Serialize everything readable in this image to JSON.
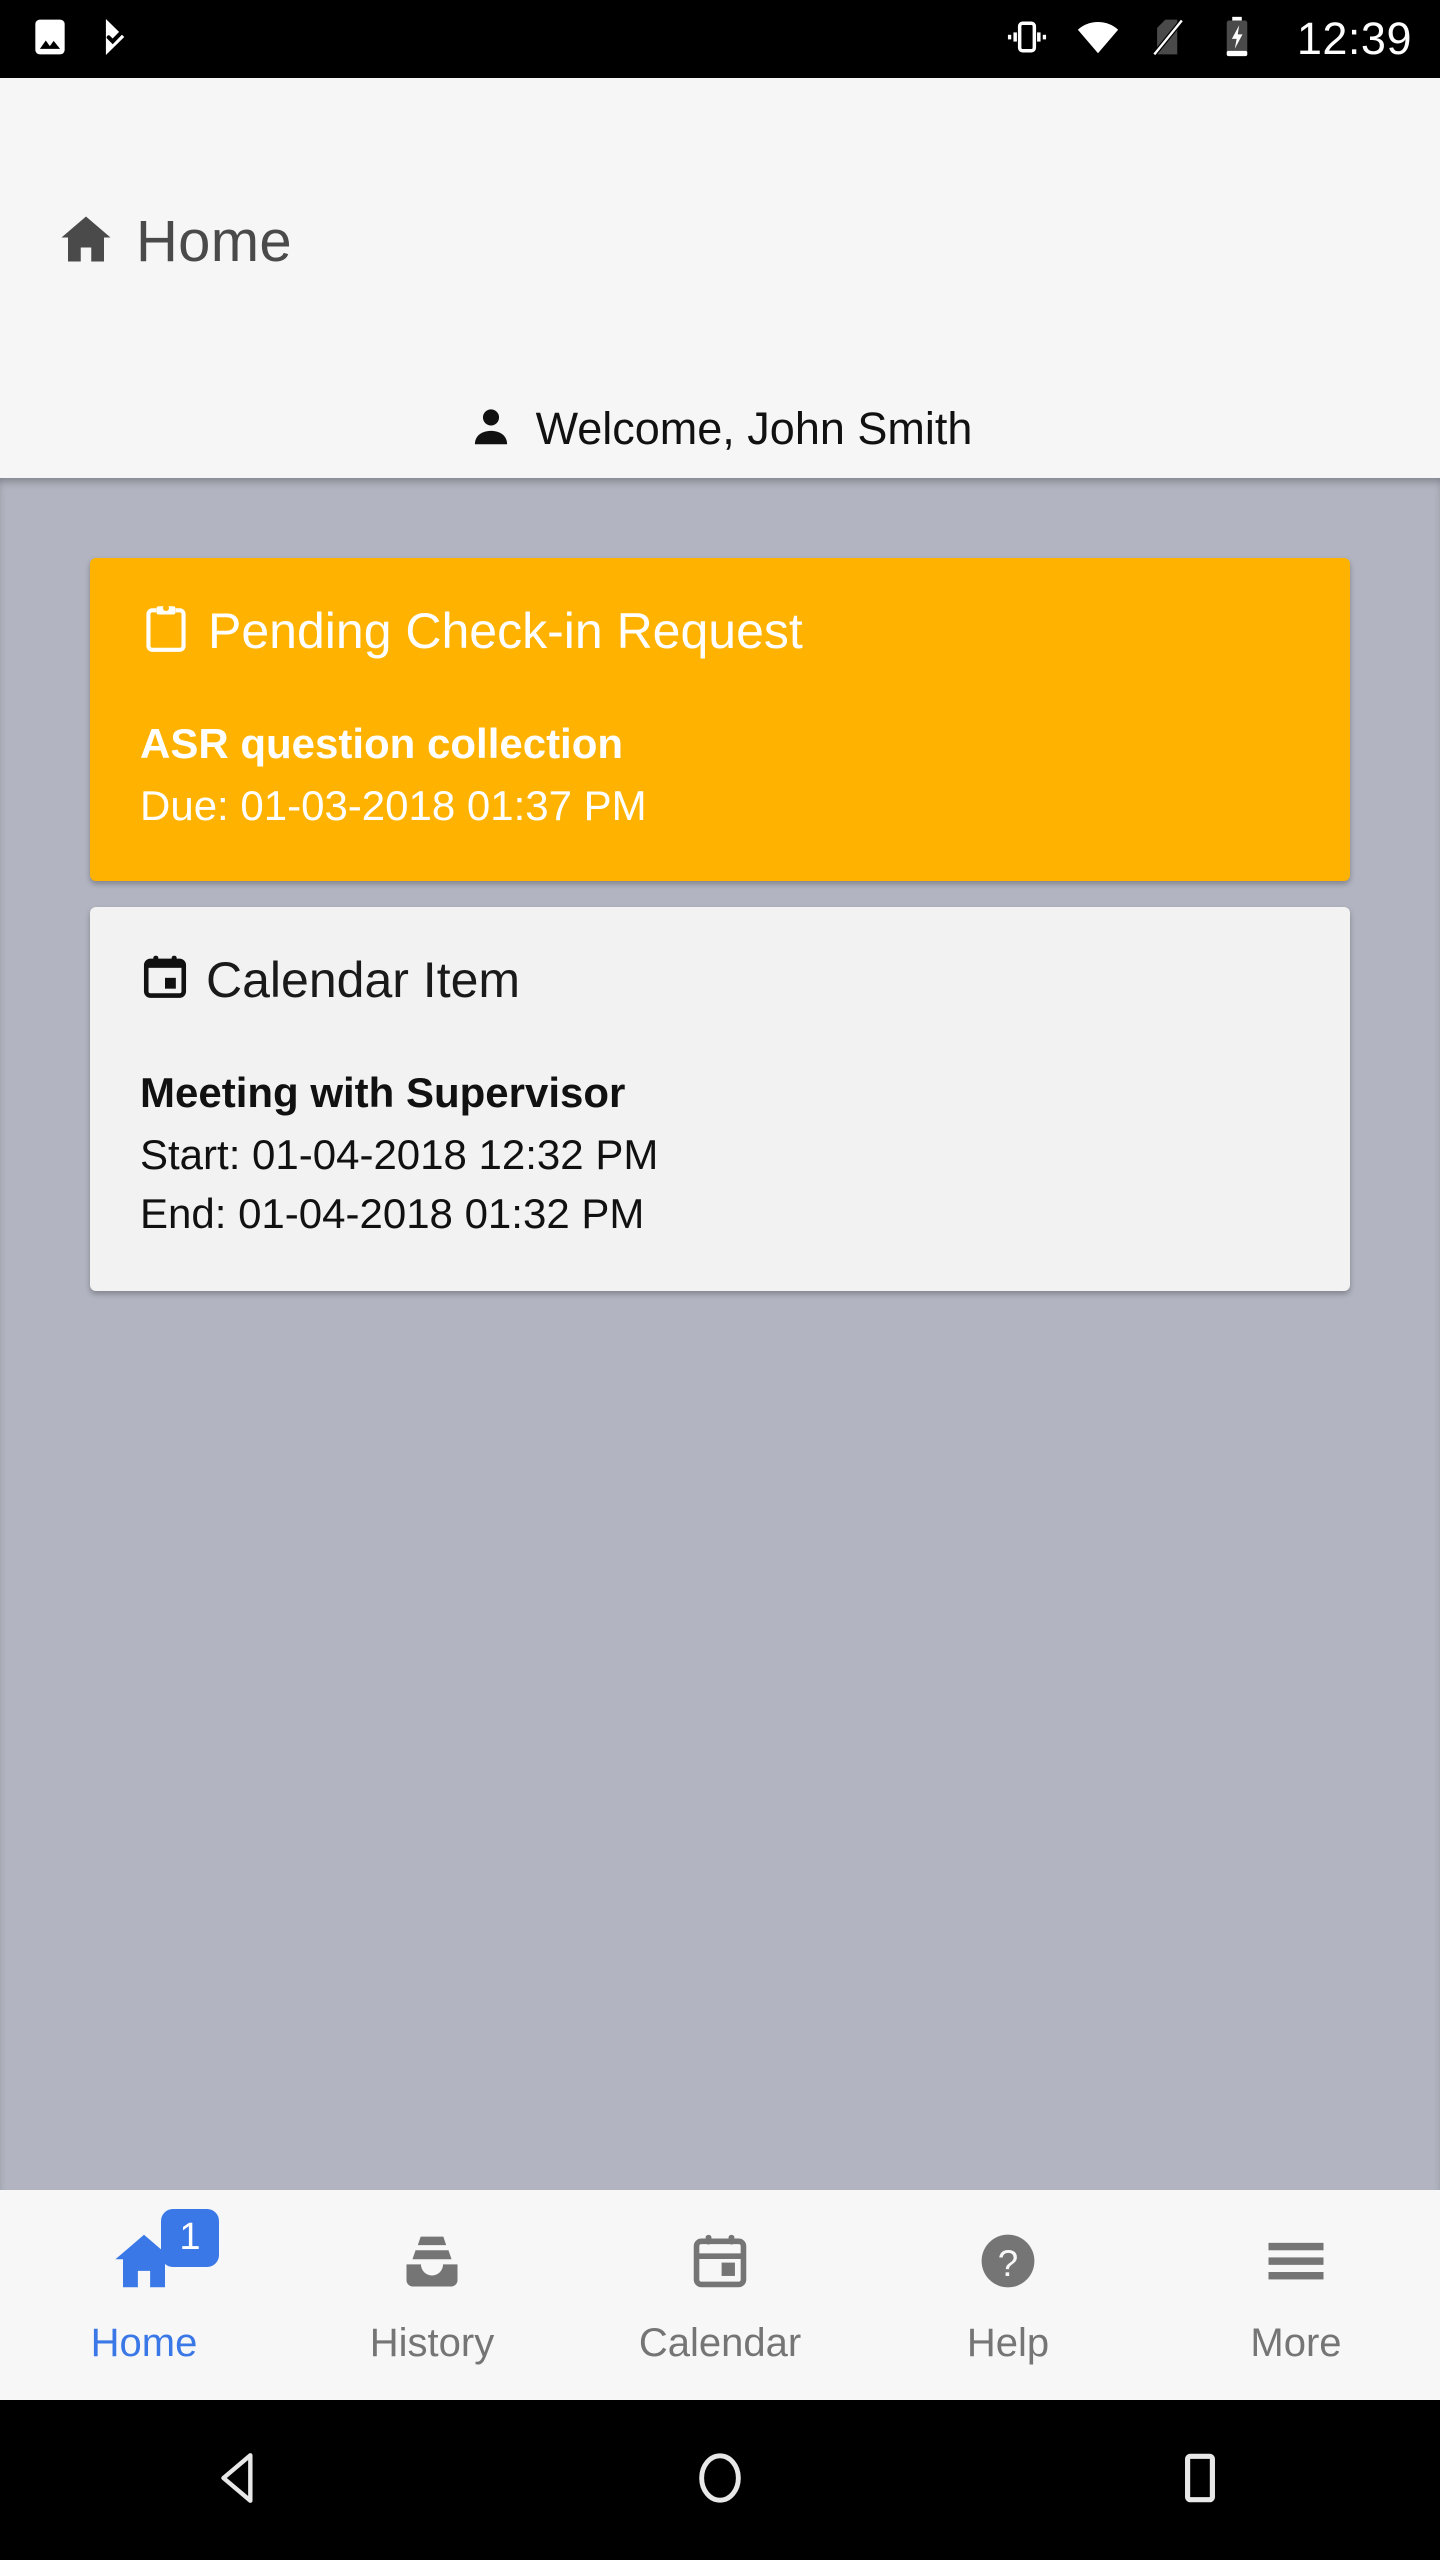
{
  "status_bar": {
    "time": "12:39",
    "left_icons": [
      "screenshot-image-icon",
      "check-chevron-icon"
    ],
    "right_icons": [
      "vibrate-icon",
      "wifi-icon",
      "no-sim-icon",
      "battery-charging-icon"
    ]
  },
  "header": {
    "icon": "home-icon",
    "title": "Home",
    "welcome_icon": "person-icon",
    "welcome_text": "Welcome, John Smith"
  },
  "cards": {
    "pending": {
      "icon": "clipboard-icon",
      "title": "Pending Check-in Request",
      "subtitle": "ASR question collection",
      "due": "Due: 01-03-2018 01:37 PM",
      "color": "#ffb300"
    },
    "calendar": {
      "icon": "calendar-icon",
      "title": "Calendar Item",
      "subtitle": "Meeting with Supervisor",
      "start": "Start: 01-04-2018 12:32 PM",
      "end": "End: 01-04-2018 01:32 PM",
      "color": "#f2f2f2"
    }
  },
  "tabs": [
    {
      "label": "Home",
      "icon": "home-icon",
      "badge": "1",
      "active": true
    },
    {
      "label": "History",
      "icon": "inbox-icon",
      "badge": "",
      "active": false
    },
    {
      "label": "Calendar",
      "icon": "calendar-icon",
      "badge": "",
      "active": false
    },
    {
      "label": "Help",
      "icon": "help-circle-icon",
      "badge": "",
      "active": false
    },
    {
      "label": "More",
      "icon": "hamburger-menu-icon",
      "badge": "",
      "active": false
    }
  ],
  "system_nav": {
    "back": "back-triangle-icon",
    "home": "home-circle-icon",
    "recents": "recents-square-icon"
  },
  "colors": {
    "accent_blue": "#3b78e7",
    "warning_orange": "#ffb300",
    "content_bg": "#b2b5c1",
    "header_bg": "#f6f6f6",
    "tabbar_bg": "#f7f7f7",
    "inactive_gray": "#757575"
  }
}
